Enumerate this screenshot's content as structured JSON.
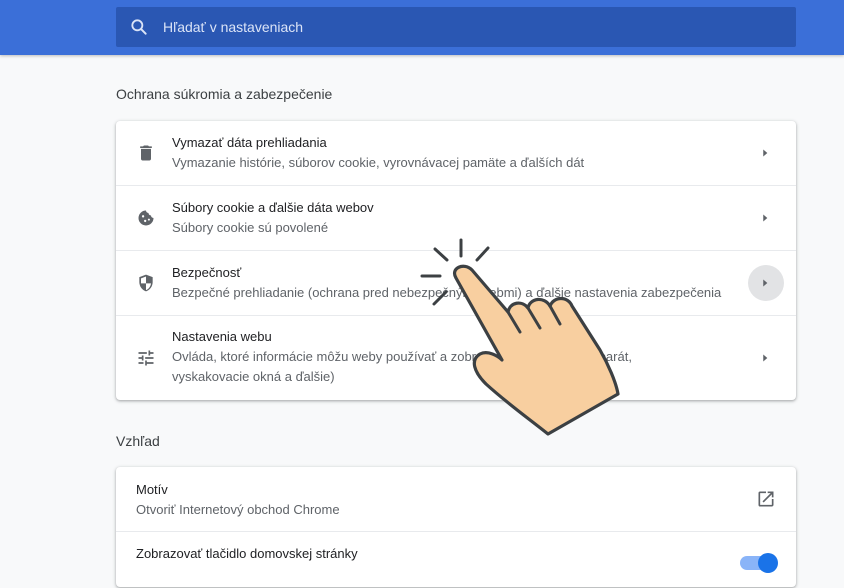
{
  "search": {
    "placeholder": "Hľadať v nastaveniach"
  },
  "privacy": {
    "title": "Ochrana súkromia a zabezpečenie",
    "rows": [
      {
        "icon": "trash-icon",
        "label": "Vymazať dáta prehliadania",
        "sub": "Vymazanie histórie, súborov cookie, vyrovnávacej pamäte a ďalších dát"
      },
      {
        "icon": "cookie-icon",
        "label": "Súbory cookie a ďalšie dáta webov",
        "sub": "Súbory cookie sú povolené"
      },
      {
        "icon": "shield-icon",
        "label": "Bezpečnosť",
        "sub": "Bezpečné prehliadanie (ochrana pred nebezpečnými webmi) a ďalšie nastavenia zabezpečenia"
      },
      {
        "icon": "tune-icon",
        "label": "Nastavenia webu",
        "sub": "Ovláda, ktoré informácie môžu weby používať a zobrazovať (poloha, fotoaparát, vyskakovacie okná a ďalšie)"
      }
    ]
  },
  "appearance": {
    "title": "Vzhľad",
    "rows": [
      {
        "label": "Motív",
        "sub": "Otvoriť Internetový obchod Chrome",
        "icon": "open-in-new-icon"
      },
      {
        "label": "Zobrazovať tlačidlo domovskej stránky",
        "toggle": true
      }
    ]
  },
  "colors": {
    "header": "#3b6fd8",
    "search_bg": "#2a57b3",
    "accent": "#1a73e8",
    "hand": "#f8cfa0"
  }
}
